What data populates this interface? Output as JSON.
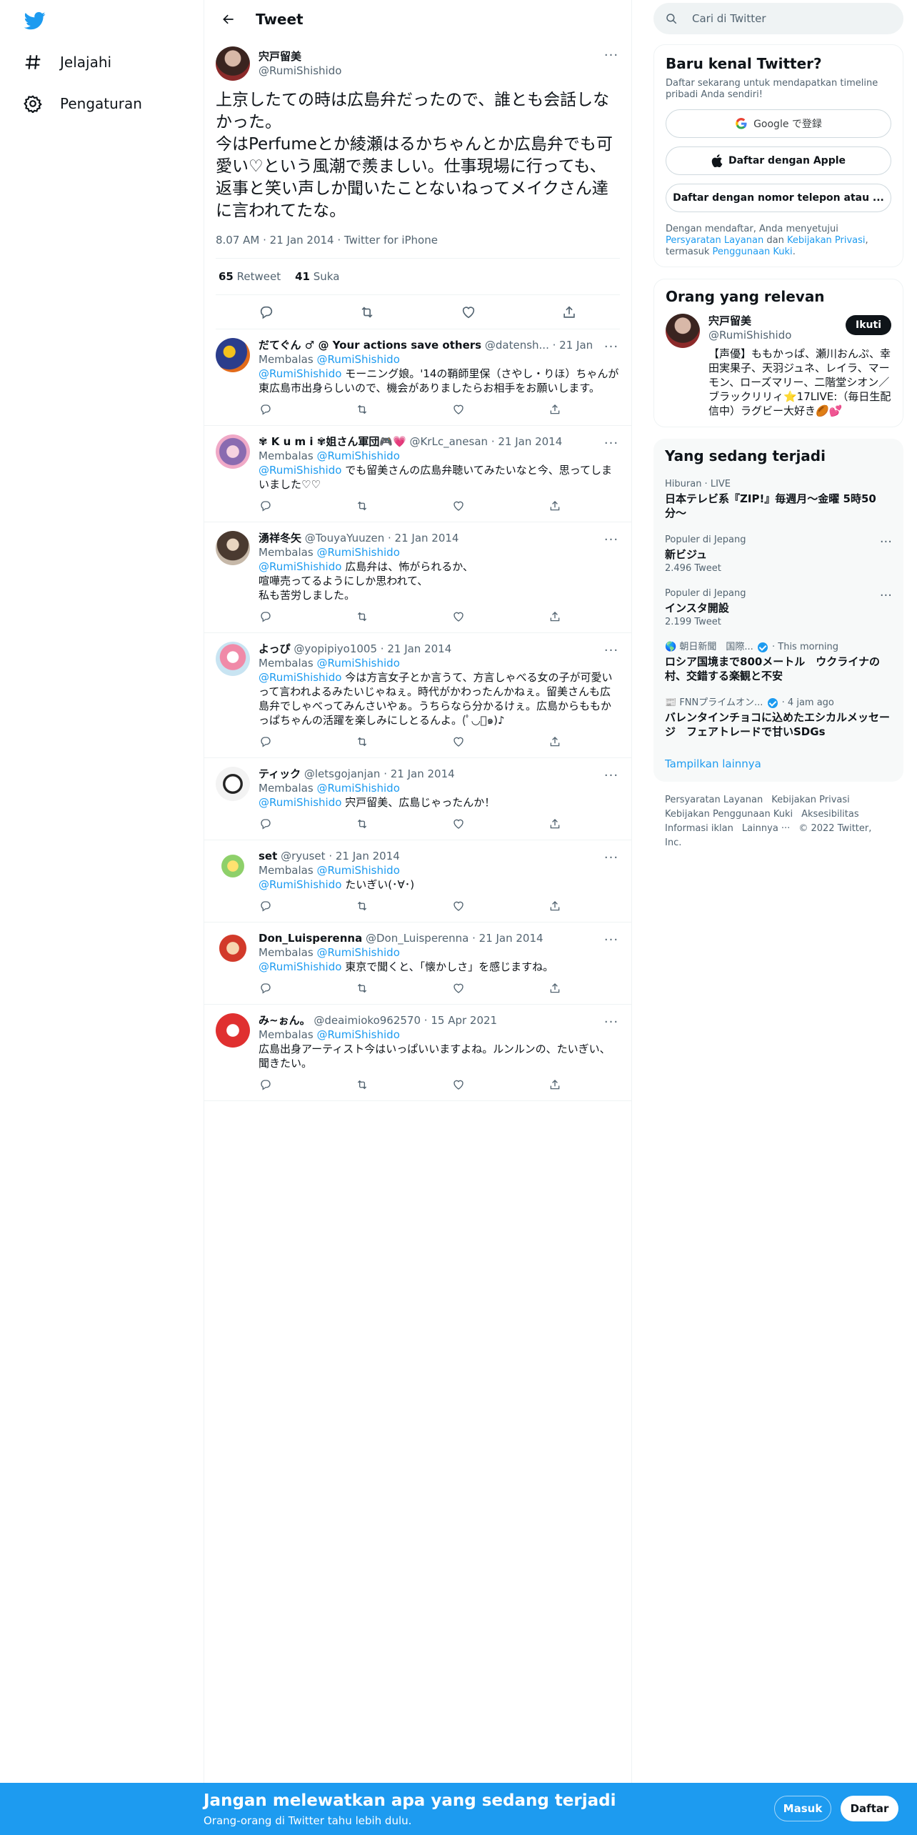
{
  "nav": {
    "explore": "Jelajahi",
    "settings": "Pengaturan"
  },
  "header": {
    "title": "Tweet"
  },
  "focal": {
    "name": "宍戸留美",
    "handle": "@RumiShishido",
    "text": "上京したての時は広島弁だったので、誰とも会話しなかった。\n今はPerfumeとか綾瀬はるかちゃんとか広島弁でも可愛い♡という風潮で羨ましい。仕事現場に行っても、返事と笑い声しか聞いたことないねってメイクさん達に言われてたな。",
    "meta": "8.07 AM · 21 Jan 2014 · Twitter for iPhone",
    "retweets": "65",
    "retweets_label": "Retweet",
    "likes": "41",
    "likes_label": "Suka"
  },
  "replies": [
    {
      "name": "だてぐん ♂ @ Your actions save others",
      "handle": "@datensh...",
      "date": "· 21 Jan 2014",
      "replying": "Membalas",
      "to": "@RumiShishido",
      "mention": "@RumiShishido",
      "text": " モーニング娘。'14の鞘師里保（さやし・りほ）ちゃんが東広島市出身らしいので、機会がありましたらお相手をお願いします。"
    },
    {
      "name": "✾ K u m i ✾姐さん軍団🎮💗",
      "handle": "@KrLc_anesan",
      "date": "· 21 Jan 2014",
      "replying": "Membalas",
      "to": "@RumiShishido",
      "mention": "@RumiShishido",
      "text": " でも留美さんの広島弁聴いてみたいなと今、思ってしまいました♡♡"
    },
    {
      "name": "湧祥冬矢",
      "handle": "@TouyaYuuzen",
      "date": "· 21 Jan 2014",
      "replying": "Membalas",
      "to": "@RumiShishido",
      "mention": "@RumiShishido",
      "text": " 広島弁は、怖がられるか、\n喧嘩売ってるようにしか思われて、\n私も苦労しました。"
    },
    {
      "name": "よっぴ",
      "handle": "@yopipiyo1005",
      "date": "· 21 Jan 2014",
      "replying": "Membalas",
      "to": "@RumiShishido",
      "mention": "@RumiShishido",
      "text": " 今は方言女子とか言うて、方言しゃべる女の子が可愛いって言われよるみたいじゃねぇ。時代がかわったんかねぇ。留美さんも広島弁でしゃべってみんさいやぁ。うちらなら分かるけぇ。広島からももかっぱちゃんの活躍を楽しみにしとるんよ。(ﾟ◡ﾟ๑)♪"
    },
    {
      "name": "ティック",
      "handle": "@letsgojanjan",
      "date": "· 21 Jan 2014",
      "replying": "Membalas",
      "to": "@RumiShishido",
      "mention": "@RumiShishido",
      "text": " 宍戸留美、広島じゃったんか！"
    },
    {
      "name": "set",
      "handle": "@ryuset",
      "date": "· 21 Jan 2014",
      "replying": "Membalas",
      "to": "@RumiShishido",
      "mention": "@RumiShishido",
      "text": " たいぎい(･∀･)"
    },
    {
      "name": "Don_Luisperenna",
      "handle": "@Don_Luisperenna",
      "date": "· 21 Jan 2014",
      "replying": "Membalas",
      "to": "@RumiShishido",
      "mention": "@RumiShishido",
      "text": " 東京で聞くと、「懐かしさ」を感じますね。"
    },
    {
      "name": "み~ぉん。",
      "handle": "@deaimioko962570",
      "date": "· 15 Apr 2021",
      "replying": "Membalas",
      "to": "@RumiShishido",
      "mention": "",
      "text": "広島出身アーティスト今はいっぱいいますよね。ルンルンの、たいぎい、聞きたい。"
    }
  ],
  "search": {
    "placeholder": "Cari di Twitter"
  },
  "signup": {
    "title": "Baru kenal Twitter?",
    "sub": "Daftar sekarang untuk mendapatkan timeline pribadi Anda sendiri!",
    "google": "Google で登録",
    "apple": "Daftar dengan Apple",
    "phone": "Daftar dengan nomor telepon atau ...",
    "legal_pre": "Dengan mendaftar, Anda menyetujui ",
    "legal_tos": "Persyaratan Layanan",
    "legal_and": " dan ",
    "legal_privacy": "Kebijakan Privasi",
    "legal_incl": ", termasuk ",
    "legal_cookie": "Penggunaan Kuki",
    "legal_end": "."
  },
  "relevant": {
    "title": "Orang yang relevan",
    "name": "宍戸留美",
    "handle": "@RumiShishido",
    "follow": "Ikuti",
    "bio": "【声優】ももかっぱ、瀬川おんぷ、幸田実果子、天羽ジュネ、レイラ、マーモン、ローズマリー、二階堂シオン／ブラックリリィ⭐17LIVE:（毎日生配信中）ラグビー大好き🏉💕"
  },
  "trends": {
    "title": "Yang sedang terjadi",
    "items": [
      {
        "cat": "Hiburan · LIVE",
        "name": "日本テレビ系『ZIP!』毎週月〜金曜 5時50分〜",
        "count": ""
      },
      {
        "cat": "Populer di Jepang",
        "name": "新ビジュ",
        "count": "2.496 Tweet"
      },
      {
        "cat": "Populer di Jepang",
        "name": "インスタ開設",
        "count": "2.199 Tweet"
      },
      {
        "cat": "🌎 朝日新聞　国際...",
        "cat2": "· This morning",
        "name": "ロシア国境まで800メートル　ウクライナの村、交錯する楽観と不安",
        "count": ""
      },
      {
        "cat": "📰 FNNプライムオン...",
        "cat2": "· 4 jam ago",
        "name": "バレンタインチョコに込めたエシカルメッセージ　フェアトレードで甘いSDGs",
        "count": ""
      }
    ],
    "show_more": "Tampilkan lainnya"
  },
  "footer": {
    "links": [
      "Persyaratan Layanan",
      "Kebijakan Privasi",
      "Kebijakan Penggunaan Kuki",
      "Aksesibilitas",
      "Informasi iklan",
      "Lainnya ···",
      "© 2022 Twitter, Inc."
    ]
  },
  "bottombar": {
    "title": "Jangan melewatkan apa yang sedang terjadi",
    "sub": "Orang-orang di Twitter tahu lebih dulu.",
    "login": "Masuk",
    "signup": "Daftar"
  },
  "colors": {
    "accent": "#1d9bf0",
    "text": "#0f1419",
    "muted": "#536471"
  }
}
